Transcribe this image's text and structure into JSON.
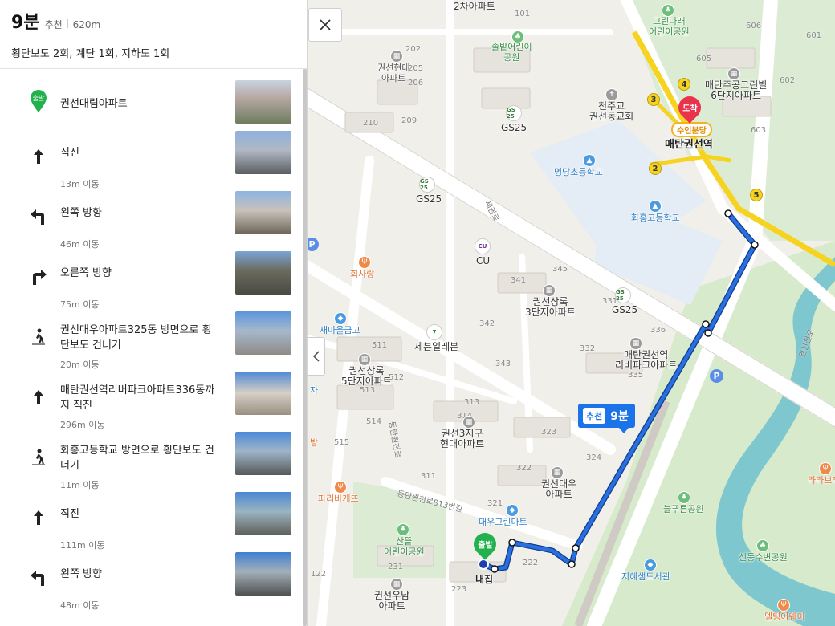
{
  "header": {
    "time": "9분",
    "recommend": "추천",
    "distance": "620m",
    "summary": "횡단보도 2회, 계단 1회, 지하도 1회"
  },
  "steps": [
    {
      "icon": "start-pin-icon",
      "badge": "출발",
      "text": "권선대림아파트",
      "dist": ""
    },
    {
      "icon": "straight-arrow-icon",
      "text": "직진",
      "dist": "13m 이동"
    },
    {
      "icon": "turn-left-icon",
      "text": "왼쪽 방향",
      "dist": "46m 이동"
    },
    {
      "icon": "turn-right-icon",
      "text": "오른쪽 방향",
      "dist": "75m 이동"
    },
    {
      "icon": "pedestrian-crossing-icon",
      "text": "권선대우아파트325동 방면으로 횡단보도 건너기",
      "dist": "20m 이동"
    },
    {
      "icon": "straight-arrow-icon",
      "text": "매탄권선역리버파크아파트336동까지 직진",
      "dist": "296m 이동"
    },
    {
      "icon": "pedestrian-crossing-icon",
      "text": "화홍고등학교 방면으로 횡단보도 건너기",
      "dist": "11m 이동"
    },
    {
      "icon": "straight-arrow-icon",
      "text": "직진",
      "dist": "111m 이동"
    },
    {
      "icon": "turn-left-icon",
      "text": "왼쪽 방향",
      "dist": "48m 이동"
    }
  ],
  "map": {
    "route_badge": {
      "tag": "추천",
      "time": "9분"
    },
    "start_pin": "출발",
    "end_pin": "도착",
    "start_label": "내집",
    "station_tag": "수인분당",
    "labels": [
      {
        "id": "geuril",
        "text": "그린나래\n어린이공원",
        "cls": "green"
      },
      {
        "id": "solbat",
        "text": "솔밭어린이\n공원",
        "cls": "green"
      },
      {
        "id": "hyundai",
        "text": "권선현대\n아파트",
        "cls": ""
      },
      {
        "id": "church",
        "text": "천주교\n권선동교회",
        "cls": "dark"
      },
      {
        "id": "maetan-green",
        "text": "매탄주공그린빌\n6단지아파트",
        "cls": "dark"
      },
      {
        "id": "station",
        "text": "매탄권선역",
        "cls": "bold"
      },
      {
        "id": "gs25a",
        "text": "GS25",
        "cls": "dark"
      },
      {
        "id": "gs25b",
        "text": "GS25",
        "cls": "dark"
      },
      {
        "id": "gs25c",
        "text": "GS25",
        "cls": "dark"
      },
      {
        "id": "myungdang",
        "text": "명당초등학교",
        "cls": "blue"
      },
      {
        "id": "hwahong",
        "text": "화홍고등학교",
        "cls": "blue"
      },
      {
        "id": "cu",
        "text": "CU",
        "cls": "dark"
      },
      {
        "id": "hoesarang",
        "text": "회사랑",
        "cls": "orange"
      },
      {
        "id": "sangrok3",
        "text": "권선상록\n3단지아파트",
        "cls": "dark"
      },
      {
        "id": "saemaeul",
        "text": "새마을금고",
        "cls": "blue"
      },
      {
        "id": "seven",
        "text": "세븐일레븐",
        "cls": "dark"
      },
      {
        "id": "riverpark",
        "text": "매탄권선역\n리버파크아파트",
        "cls": "dark"
      },
      {
        "id": "sangrok5",
        "text": "권선상록\n5단지아파트",
        "cls": "dark"
      },
      {
        "id": "hyundai3",
        "text": "권선3지구\n현대아파트",
        "cls": "dark"
      },
      {
        "id": "daewoo",
        "text": "권선대우\n아파트",
        "cls": "dark"
      },
      {
        "id": "paris",
        "text": "파리바게뜨",
        "cls": "orange"
      },
      {
        "id": "daewoogreen",
        "text": "대우그린마트",
        "cls": "blue"
      },
      {
        "id": "neulpureun",
        "text": "늘푸른공원",
        "cls": "green"
      },
      {
        "id": "sanddeul",
        "text": "산뜰\n어린이공원",
        "cls": "green"
      },
      {
        "id": "jihye",
        "text": "지혜샘도서관",
        "cls": "blue"
      },
      {
        "id": "sindong",
        "text": "신동수변공원",
        "cls": "green"
      },
      {
        "id": "woonam",
        "text": "권선우남\n아파트",
        "cls": "dark"
      },
      {
        "id": "melting",
        "text": "멜팅어웨이",
        "cls": "orange"
      },
      {
        "id": "larabread",
        "text": "라라브레",
        "cls": "orange"
      },
      {
        "id": "cha2",
        "text": "2차아파트",
        "cls": "dark"
      },
      {
        "id": "ja",
        "text": "자",
        "cls": "blue"
      },
      {
        "id": "bang",
        "text": "방",
        "cls": "orange"
      }
    ],
    "block_numbers": [
      "101",
      "202",
      "206",
      "209",
      "210",
      "205",
      "601",
      "606",
      "605",
      "602",
      "603",
      "345",
      "341",
      "331",
      "336",
      "342",
      "343",
      "332",
      "335",
      "511",
      "512",
      "513",
      "514",
      "515",
      "313",
      "314",
      "323",
      "324",
      "322",
      "321",
      "311",
      "231",
      "223",
      "222",
      "122"
    ],
    "road_names": [
      "세권로",
      "동탄원천로813번길",
      "동탄원천로",
      "권선천로"
    ],
    "subway_exits": [
      "2",
      "3",
      "4",
      "5"
    ],
    "store_tags": {
      "gs": "GS 25",
      "cu": "CU",
      "seven": "7"
    }
  }
}
